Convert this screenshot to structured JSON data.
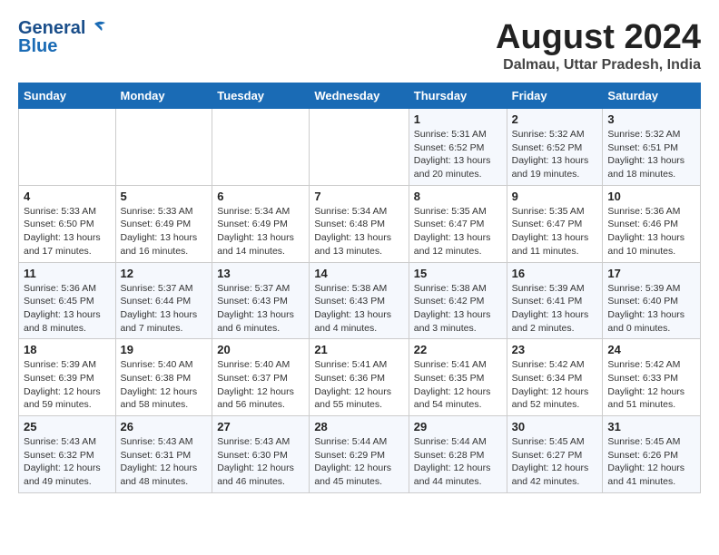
{
  "header": {
    "logo_line1": "General",
    "logo_line2": "Blue",
    "month_title": "August 2024",
    "location": "Dalmau, Uttar Pradesh, India"
  },
  "calendar": {
    "days_of_week": [
      "Sunday",
      "Monday",
      "Tuesday",
      "Wednesday",
      "Thursday",
      "Friday",
      "Saturday"
    ],
    "weeks": [
      [
        {
          "day": "",
          "text": ""
        },
        {
          "day": "",
          "text": ""
        },
        {
          "day": "",
          "text": ""
        },
        {
          "day": "",
          "text": ""
        },
        {
          "day": "1",
          "text": "Sunrise: 5:31 AM\nSunset: 6:52 PM\nDaylight: 13 hours and 20 minutes."
        },
        {
          "day": "2",
          "text": "Sunrise: 5:32 AM\nSunset: 6:52 PM\nDaylight: 13 hours and 19 minutes."
        },
        {
          "day": "3",
          "text": "Sunrise: 5:32 AM\nSunset: 6:51 PM\nDaylight: 13 hours and 18 minutes."
        }
      ],
      [
        {
          "day": "4",
          "text": "Sunrise: 5:33 AM\nSunset: 6:50 PM\nDaylight: 13 hours and 17 minutes."
        },
        {
          "day": "5",
          "text": "Sunrise: 5:33 AM\nSunset: 6:49 PM\nDaylight: 13 hours and 16 minutes."
        },
        {
          "day": "6",
          "text": "Sunrise: 5:34 AM\nSunset: 6:49 PM\nDaylight: 13 hours and 14 minutes."
        },
        {
          "day": "7",
          "text": "Sunrise: 5:34 AM\nSunset: 6:48 PM\nDaylight: 13 hours and 13 minutes."
        },
        {
          "day": "8",
          "text": "Sunrise: 5:35 AM\nSunset: 6:47 PM\nDaylight: 13 hours and 12 minutes."
        },
        {
          "day": "9",
          "text": "Sunrise: 5:35 AM\nSunset: 6:47 PM\nDaylight: 13 hours and 11 minutes."
        },
        {
          "day": "10",
          "text": "Sunrise: 5:36 AM\nSunset: 6:46 PM\nDaylight: 13 hours and 10 minutes."
        }
      ],
      [
        {
          "day": "11",
          "text": "Sunrise: 5:36 AM\nSunset: 6:45 PM\nDaylight: 13 hours and 8 minutes."
        },
        {
          "day": "12",
          "text": "Sunrise: 5:37 AM\nSunset: 6:44 PM\nDaylight: 13 hours and 7 minutes."
        },
        {
          "day": "13",
          "text": "Sunrise: 5:37 AM\nSunset: 6:43 PM\nDaylight: 13 hours and 6 minutes."
        },
        {
          "day": "14",
          "text": "Sunrise: 5:38 AM\nSunset: 6:43 PM\nDaylight: 13 hours and 4 minutes."
        },
        {
          "day": "15",
          "text": "Sunrise: 5:38 AM\nSunset: 6:42 PM\nDaylight: 13 hours and 3 minutes."
        },
        {
          "day": "16",
          "text": "Sunrise: 5:39 AM\nSunset: 6:41 PM\nDaylight: 13 hours and 2 minutes."
        },
        {
          "day": "17",
          "text": "Sunrise: 5:39 AM\nSunset: 6:40 PM\nDaylight: 13 hours and 0 minutes."
        }
      ],
      [
        {
          "day": "18",
          "text": "Sunrise: 5:39 AM\nSunset: 6:39 PM\nDaylight: 12 hours and 59 minutes."
        },
        {
          "day": "19",
          "text": "Sunrise: 5:40 AM\nSunset: 6:38 PM\nDaylight: 12 hours and 58 minutes."
        },
        {
          "day": "20",
          "text": "Sunrise: 5:40 AM\nSunset: 6:37 PM\nDaylight: 12 hours and 56 minutes."
        },
        {
          "day": "21",
          "text": "Sunrise: 5:41 AM\nSunset: 6:36 PM\nDaylight: 12 hours and 55 minutes."
        },
        {
          "day": "22",
          "text": "Sunrise: 5:41 AM\nSunset: 6:35 PM\nDaylight: 12 hours and 54 minutes."
        },
        {
          "day": "23",
          "text": "Sunrise: 5:42 AM\nSunset: 6:34 PM\nDaylight: 12 hours and 52 minutes."
        },
        {
          "day": "24",
          "text": "Sunrise: 5:42 AM\nSunset: 6:33 PM\nDaylight: 12 hours and 51 minutes."
        }
      ],
      [
        {
          "day": "25",
          "text": "Sunrise: 5:43 AM\nSunset: 6:32 PM\nDaylight: 12 hours and 49 minutes."
        },
        {
          "day": "26",
          "text": "Sunrise: 5:43 AM\nSunset: 6:31 PM\nDaylight: 12 hours and 48 minutes."
        },
        {
          "day": "27",
          "text": "Sunrise: 5:43 AM\nSunset: 6:30 PM\nDaylight: 12 hours and 46 minutes."
        },
        {
          "day": "28",
          "text": "Sunrise: 5:44 AM\nSunset: 6:29 PM\nDaylight: 12 hours and 45 minutes."
        },
        {
          "day": "29",
          "text": "Sunrise: 5:44 AM\nSunset: 6:28 PM\nDaylight: 12 hours and 44 minutes."
        },
        {
          "day": "30",
          "text": "Sunrise: 5:45 AM\nSunset: 6:27 PM\nDaylight: 12 hours and 42 minutes."
        },
        {
          "day": "31",
          "text": "Sunrise: 5:45 AM\nSunset: 6:26 PM\nDaylight: 12 hours and 41 minutes."
        }
      ]
    ]
  }
}
